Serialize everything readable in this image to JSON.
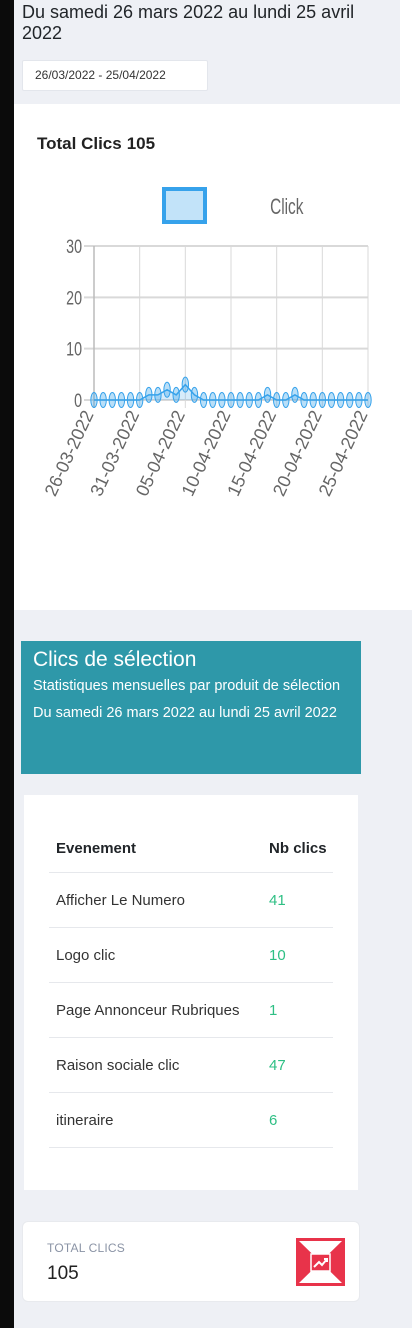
{
  "header": {
    "date_range_text": "Du samedi 26 mars 2022 au lundi 25 avril 2022",
    "date_picker_value": "26/03/2022 - 25/04/2022"
  },
  "chart_card": {
    "title_label": "Total Clics",
    "title_value": "105"
  },
  "chart_data": {
    "type": "line",
    "title": "Total Clics 105",
    "legend_position": "top-center",
    "series": [
      {
        "name": "Click",
        "color": "#36a2eb",
        "values": [
          0,
          0,
          0,
          0,
          0,
          0,
          1,
          1,
          2,
          1,
          3,
          1,
          0,
          0,
          0,
          0,
          0,
          0,
          0,
          1,
          0,
          0,
          1,
          0,
          0,
          0,
          0,
          0,
          0,
          0,
          0
        ]
      }
    ],
    "x": [
      "26-03-2022",
      "27-03-2022",
      "28-03-2022",
      "29-03-2022",
      "30-03-2022",
      "31-03-2022",
      "01-04-2022",
      "02-04-2022",
      "03-04-2022",
      "04-04-2022",
      "05-04-2022",
      "06-04-2022",
      "07-04-2022",
      "08-04-2022",
      "09-04-2022",
      "10-04-2022",
      "11-04-2022",
      "12-04-2022",
      "13-04-2022",
      "14-04-2022",
      "15-04-2022",
      "16-04-2022",
      "17-04-2022",
      "18-04-2022",
      "19-04-2022",
      "20-04-2022",
      "21-04-2022",
      "22-04-2022",
      "23-04-2022",
      "24-04-2022",
      "25-04-2022"
    ],
    "x_tick_labels": [
      "26-03-2022",
      "31-03-2022",
      "05-04-2022",
      "10-04-2022",
      "15-04-2022",
      "20-04-2022",
      "25-04-2022"
    ],
    "y_ticks": [
      0,
      10,
      20,
      30
    ],
    "ylim": [
      0,
      30
    ],
    "grid": true
  },
  "selection_section": {
    "title": "Clics de sélection",
    "subtitle": "Statistiques mensuelles par produit de sélection Du samedi 26 mars 2022 au lundi 25 avril 2022"
  },
  "stats_table": {
    "columns": [
      "Evenement",
      "Nb clics"
    ],
    "rows": [
      {
        "event": "Afficher Le Numero",
        "clicks": "41"
      },
      {
        "event": "Logo clic",
        "clicks": "10"
      },
      {
        "event": "Page Annonceur Rubriques",
        "clicks": "1"
      },
      {
        "event": "Raison sociale clic",
        "clicks": "47"
      },
      {
        "event": "itineraire",
        "clicks": "6"
      }
    ]
  },
  "total": {
    "label": "TOTAL CLICS",
    "value": "105",
    "icon": "chart-trend-icon",
    "icon_color": "#e8334a"
  }
}
